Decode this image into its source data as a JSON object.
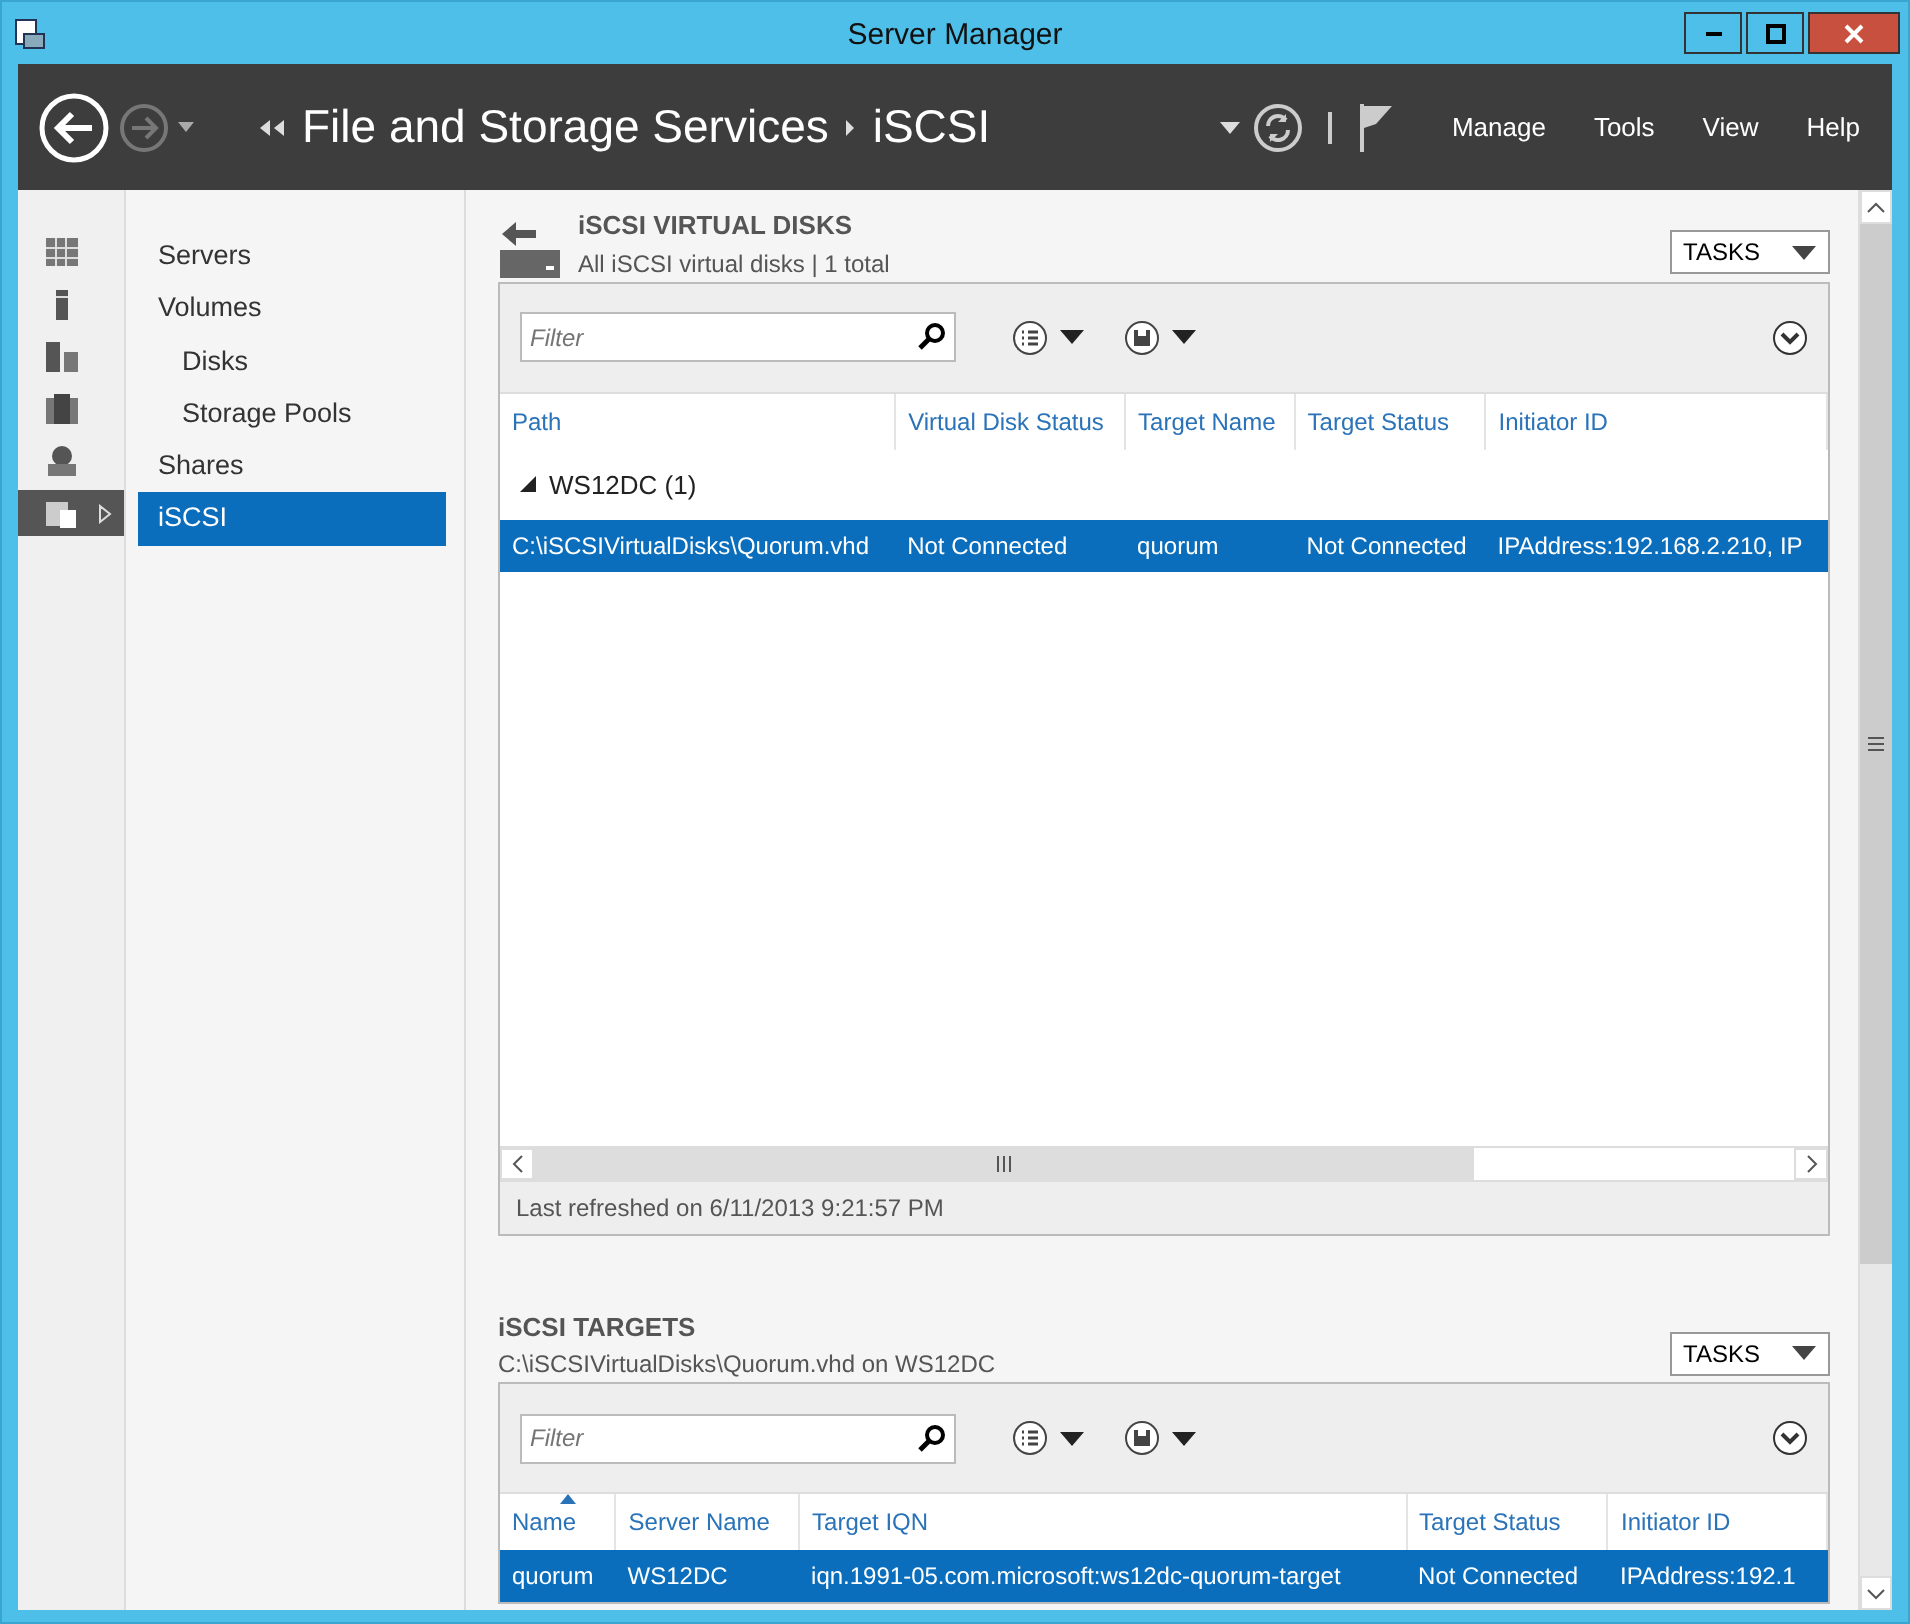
{
  "window": {
    "title": "Server Manager"
  },
  "header": {
    "breadcrumb": [
      "File and Storage Services",
      "iSCSI"
    ],
    "menu": [
      "Manage",
      "Tools",
      "View",
      "Help"
    ]
  },
  "rail": [
    {
      "kind": "dashboard",
      "selected": false
    },
    {
      "kind": "server",
      "selected": false
    },
    {
      "kind": "servers",
      "selected": false
    },
    {
      "kind": "group",
      "selected": false
    },
    {
      "kind": "role",
      "selected": false
    },
    {
      "kind": "storage",
      "selected": true
    }
  ],
  "nav": [
    {
      "label": "Servers",
      "selected": false
    },
    {
      "label": "Volumes",
      "selected": false,
      "children": [
        {
          "label": "Disks",
          "selected": false
        },
        {
          "label": "Storage Pools",
          "selected": false
        }
      ]
    },
    {
      "label": "Shares",
      "selected": false
    },
    {
      "label": "iSCSI",
      "selected": true
    }
  ],
  "virtual_disks": {
    "title": "iSCSI VIRTUAL DISKS",
    "subtitle": "All iSCSI virtual disks | 1 total",
    "tasks": "TASKS",
    "filter": {
      "placeholder": "Filter"
    },
    "columns": [
      "Path",
      "Virtual Disk Status",
      "Target Name",
      "Target Status",
      "Initiator ID"
    ],
    "groups": [
      {
        "label": "WS12DC (1)",
        "expanded": true,
        "rows": [
          {
            "selected": true,
            "cells": [
              "C:\\iSCSIVirtualDisks\\Quorum.vhd",
              "Not Connected",
              "quorum",
              "Not Connected",
              "IPAddress:192.168.2.210, IP"
            ]
          }
        ]
      }
    ],
    "status": "Last refreshed on 6/11/2013 9:21:57 PM"
  },
  "targets": {
    "title": "iSCSI TARGETS",
    "subtitle": "C:\\iSCSIVirtualDisks\\Quorum.vhd on WS12DC",
    "tasks": "TASKS",
    "filter": {
      "placeholder": "Filter"
    },
    "columns": [
      {
        "label": "Name",
        "sorted": true
      },
      {
        "label": "Server Name",
        "sorted": false
      },
      {
        "label": "Target IQN",
        "sorted": false
      },
      {
        "label": "Target Status",
        "sorted": false
      },
      {
        "label": "Initiator ID",
        "sorted": false
      }
    ],
    "rows": [
      {
        "selected": true,
        "cells": [
          "quorum",
          "WS12DC",
          "iqn.1991-05.com.microsoft:ws12dc-quorum-target",
          "Not Connected",
          "IPAddress:192.1"
        ]
      }
    ]
  }
}
